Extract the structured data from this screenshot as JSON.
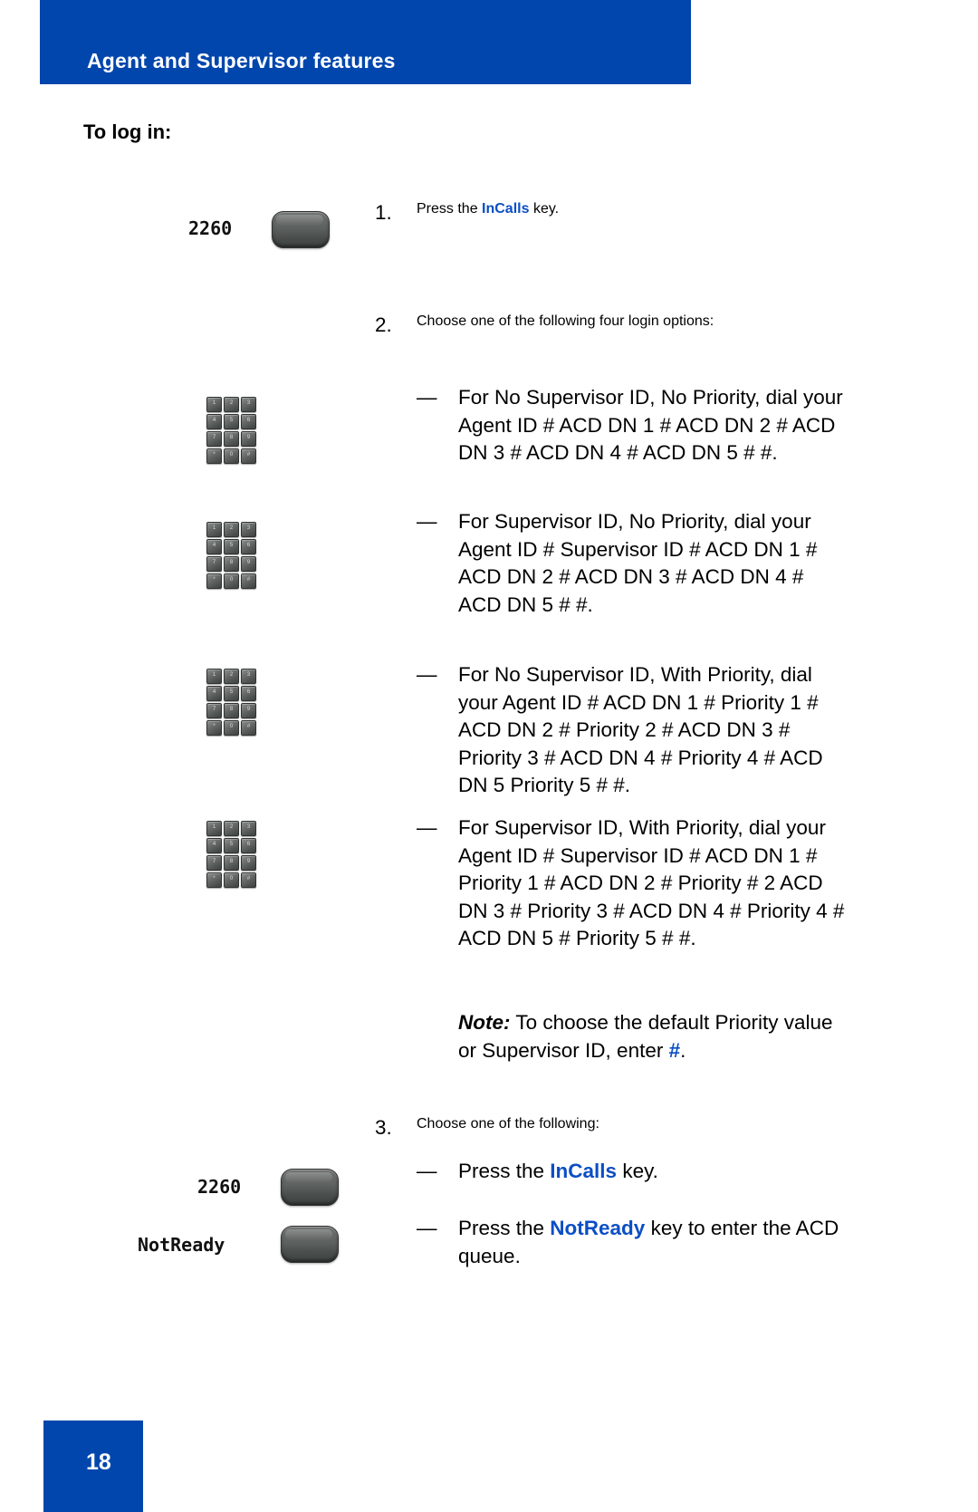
{
  "page": {
    "header_title": "Agent and Supervisor features",
    "section_heading": "To log in:",
    "page_number": "18",
    "brand_blue": "#0046ad",
    "keyword_blue": "#0b4ec4"
  },
  "steps": [
    {
      "number": "1.",
      "text_before": "Press the ",
      "keyword": "InCalls",
      "text_after": " key."
    },
    {
      "number": "2.",
      "text": "Choose one of the following four login options:"
    },
    {
      "number": "3.",
      "text": "Choose one of the following:"
    }
  ],
  "login_options": [
    {
      "dash": "—",
      "text": "For No Supervisor ID, No Priority, dial your Agent ID # ACD DN 1 # ACD DN 2 # ACD DN 3 # ACD DN 4 # ACD DN 5 # #."
    },
    {
      "dash": "—",
      "text": "For Supervisor ID, No Priority, dial your Agent ID # Supervisor ID # ACD DN 1 # ACD DN 2 # ACD DN 3 # ACD DN 4 # ACD DN 5 # #."
    },
    {
      "dash": "—",
      "text": "For No Supervisor ID, With Priority, dial your Agent ID # ACD DN 1 # Priority 1 # ACD DN 2 # Priority 2 # ACD DN 3 # Priority 3 # ACD DN 4 # Priority 4 # ACD DN 5 Priority 5 # #."
    },
    {
      "dash": "—",
      "text": "For Supervisor ID, With Priority, dial your Agent ID # Supervisor ID # ACD DN 1 # Priority 1 # ACD DN 2 # Priority # 2 ACD DN 3 # Priority 3 # ACD DN 4 # Priority 4 # ACD DN 5 # Priority 5 # #."
    }
  ],
  "note": {
    "label": "Note:",
    "text_before": " To choose the default Priority value or Supervisor ID, enter ",
    "keyword": "#",
    "text_after": "."
  },
  "final_options": [
    {
      "dash": "—",
      "text_before": "Press the ",
      "keyword": "InCalls",
      "text_after": " key."
    },
    {
      "dash": "—",
      "text_before": "Press the ",
      "keyword": "NotReady",
      "text_after": " key to enter the ACD queue."
    }
  ],
  "artwork": {
    "key_labels": {
      "incalls_top": "2260",
      "incalls_bottom": "2260",
      "notready": "NotReady"
    },
    "dialpad_keys": [
      "1",
      "2",
      "3",
      "4",
      "5",
      "6",
      "7",
      "8",
      "9",
      "*",
      "0",
      "#"
    ]
  }
}
